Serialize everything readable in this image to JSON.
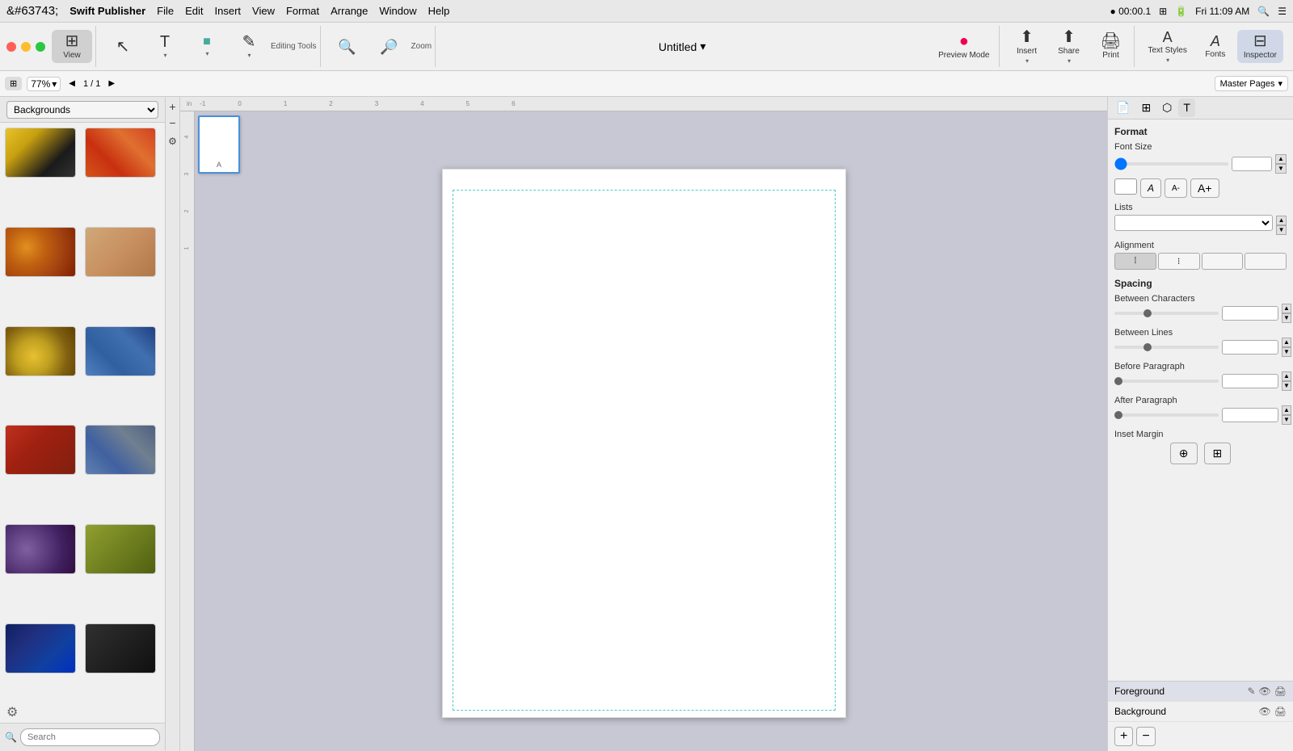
{
  "menubar": {
    "apple": "&#63743;",
    "appname": "Swift Publisher",
    "menus": [
      "File",
      "Edit",
      "Insert",
      "View",
      "Format",
      "Arrange",
      "Window",
      "Help"
    ],
    "right": {
      "recording": "00:00.1",
      "time": "Fri 11:09 AM"
    }
  },
  "toolbar": {
    "view_label": "View",
    "editing_tools_label": "Editing Tools",
    "zoom_label": "Zoom",
    "preview_label": "Preview Mode",
    "insert_label": "Insert",
    "share_label": "Share",
    "print_label": "Print",
    "text_styles_label": "Text Styles",
    "fonts_label": "Fonts",
    "inspector_label": "Inspector"
  },
  "document": {
    "title": "Untitled",
    "title_icon": "▾"
  },
  "subtoolbar": {
    "zoom_value": "77%",
    "zoom_arrow": "▾",
    "page_nav": "1 / 1",
    "master_pages": "Master Pages",
    "master_arrow": "▾"
  },
  "backgrounds_panel": {
    "label": "Backgrounds",
    "dropdown_arrow": "▾",
    "thumbnails": [
      {
        "id": 1,
        "class": "thumb-1"
      },
      {
        "id": 2,
        "class": "thumb-2"
      },
      {
        "id": 3,
        "class": "thumb-3"
      },
      {
        "id": 4,
        "class": "thumb-4"
      },
      {
        "id": 5,
        "class": "thumb-5"
      },
      {
        "id": 6,
        "class": "thumb-6"
      },
      {
        "id": 7,
        "class": "thumb-7"
      },
      {
        "id": 8,
        "class": "thumb-8"
      },
      {
        "id": 9,
        "class": "thumb-9"
      },
      {
        "id": 10,
        "class": "thumb-10"
      },
      {
        "id": 11,
        "class": "thumb-11"
      },
      {
        "id": 12,
        "class": "thumb-12"
      }
    ],
    "search_placeholder": "Search"
  },
  "inspector": {
    "tabs": [
      "document-icon",
      "layout-icon",
      "shape-icon",
      "text-icon"
    ],
    "format": {
      "title": "Format",
      "font_size_label": "Font Size",
      "lists_label": "Lists",
      "alignment_label": "Alignment",
      "alignment_btns": [
        "≡",
        "≡",
        "≡",
        "≡"
      ],
      "spacing_label": "Spacing",
      "between_chars_label": "Between Characters",
      "between_lines_label": "Between Lines",
      "before_para_label": "Before Paragraph",
      "after_para_label": "After Paragraph",
      "inset_margin_label": "Inset Margin"
    },
    "footer": {
      "foreground_label": "Foreground",
      "background_label": "Background"
    },
    "footer_actions": [
      "+",
      "−"
    ]
  }
}
